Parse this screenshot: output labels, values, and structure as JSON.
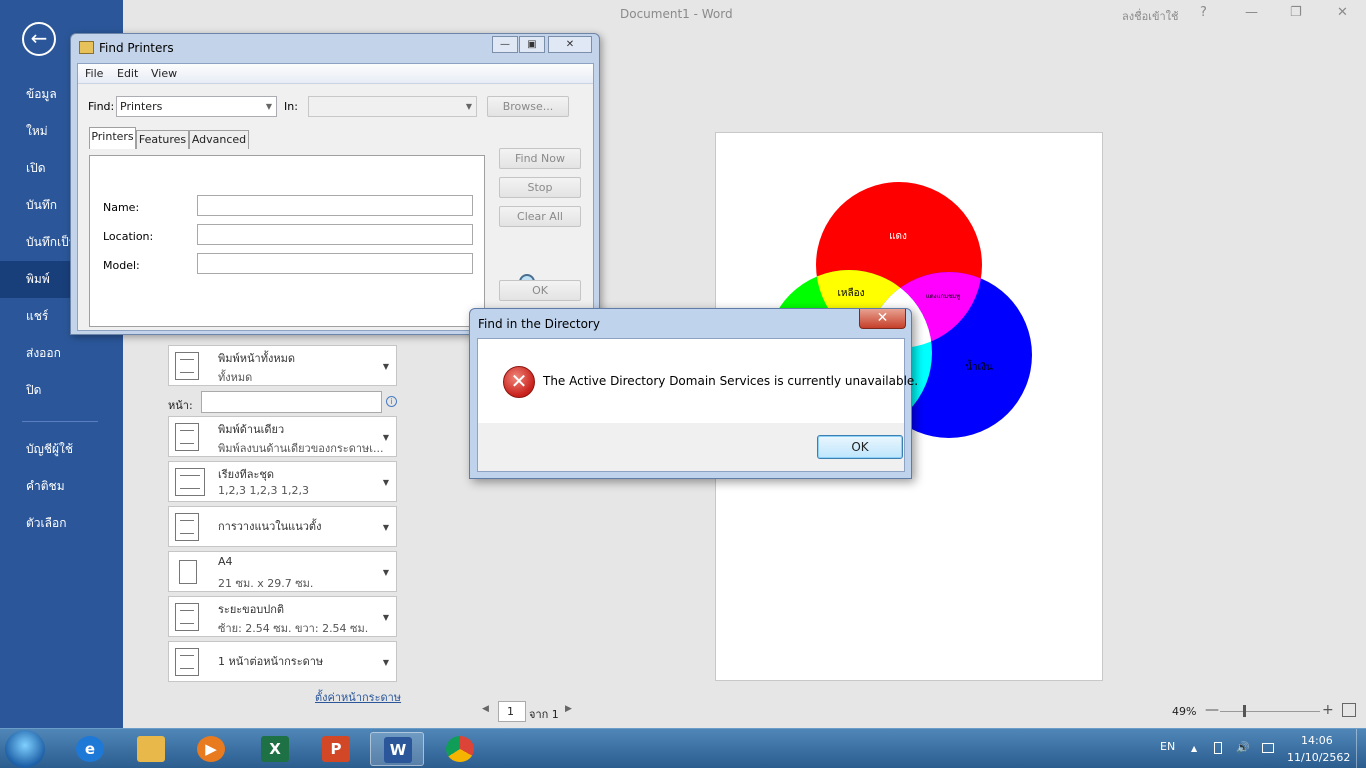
{
  "word": {
    "title": "Document1  -  Word",
    "signin": "ลงชื่อเข้าใช้",
    "help": "?",
    "minimize": "—",
    "restore": "❐",
    "close": "✕"
  },
  "sidebar": {
    "back": "←",
    "items": [
      {
        "label": "ข้อมูล"
      },
      {
        "label": "ใหม่"
      },
      {
        "label": "เปิด"
      },
      {
        "label": "บันทึก"
      },
      {
        "label": "บันทึกเป็น"
      },
      {
        "label": "พิมพ์",
        "active": true
      },
      {
        "label": "แชร์"
      },
      {
        "label": "ส่งออก"
      },
      {
        "label": "ปิด"
      },
      {
        "label": "บัญชีผู้ใช้"
      },
      {
        "label": "คำติชม"
      },
      {
        "label": "ตัวเลือก"
      }
    ]
  },
  "print_settings": {
    "pages": {
      "line1": "พิมพ์หน้าทั้งหมด",
      "line2": "ทั้งหมด"
    },
    "pages_label": "หน้า:",
    "pages_value": "",
    "info": "i",
    "sides": {
      "line1": "พิมพ์ด้านเดียว",
      "line2": "พิมพ์ลงบนด้านเดียวของกระดาษเ..."
    },
    "collate": {
      "line1": "เรียงทีละชุด",
      "line2": "1,2,3    1,2,3    1,2,3"
    },
    "orientation": {
      "line1": "การวางแนวในแนวตั้ง"
    },
    "paper": {
      "line1": "A4",
      "line2": "21 ซม. x 29.7 ซม."
    },
    "margins": {
      "line1": "ระยะขอบปกติ",
      "line2": "ซ้าย:  2.54 ซม.    ขวา:  2.54 ซม."
    },
    "per_sheet": {
      "line1": "1 หน้าต่อหน้ากระดาษ"
    },
    "page_setup_link": "ตั้งค่าหน้ากระดาษ"
  },
  "preview": {
    "red_label": "แดง",
    "yellow_label": "เหลือง",
    "magenta_label": "แดงแกมชมพู",
    "blue_label": "น้ำเงิน",
    "colors": {
      "red": "#ff0000",
      "green": "#00ff00",
      "blue": "#0000ff",
      "yellow": "#ffff00",
      "magenta": "#ff00ff",
      "cyan": "#00ffff",
      "white": "#ffffff"
    }
  },
  "nav": {
    "prev": "◀",
    "page": "1",
    "of": "จาก 1",
    "next": "▶"
  },
  "zoom": {
    "percent": "49%",
    "minus": "—",
    "plus": "+"
  },
  "find_printers": {
    "title": "Find Printers",
    "minimize": "—",
    "maximize": "▣",
    "close": "✕",
    "menu": [
      "File",
      "Edit",
      "View"
    ],
    "find_label": "Find:",
    "find_value": "Printers",
    "in_label": "In:",
    "in_value": "",
    "browse": "Browse...",
    "tabs": [
      "Printers",
      "Features",
      "Advanced"
    ],
    "name_label": "Name:",
    "location_label": "Location:",
    "model_label": "Model:",
    "name_value": "",
    "location_value": "",
    "model_value": "",
    "find_now": "Find Now",
    "stop": "Stop",
    "clear_all": "Clear All",
    "ok": "OK"
  },
  "error_dialog": {
    "title": "Find in the Directory",
    "close": "✕",
    "icon": "✕",
    "message": "The Active Directory Domain Services is currently unavailable.",
    "ok": "OK"
  },
  "taskbar": {
    "apps": [
      {
        "name": "internet-explorer",
        "glyph": "e",
        "color": "#1e78d6"
      },
      {
        "name": "file-explorer",
        "glyph": "",
        "color": "#e8b84a"
      },
      {
        "name": "media-player",
        "glyph": "▶",
        "color": "#e87a20"
      },
      {
        "name": "excel",
        "glyph": "X",
        "color": "#1e7145"
      },
      {
        "name": "powerpoint",
        "glyph": "P",
        "color": "#d24726"
      },
      {
        "name": "word",
        "glyph": "W",
        "color": "#2b579a",
        "active": true
      },
      {
        "name": "chrome",
        "glyph": "",
        "color": "#db4437"
      }
    ],
    "language": "EN",
    "tray_arrow": "▲",
    "time": "14:06",
    "date": "11/10/2562"
  }
}
